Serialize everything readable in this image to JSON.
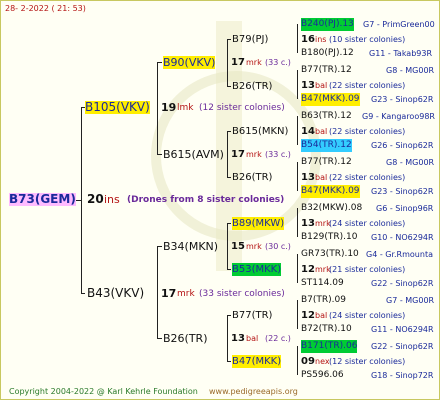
{
  "header": {
    "date": "28-  2-2022  ( 21: 53)"
  },
  "root": {
    "name": "B73(GEM)",
    "count": "20",
    "unit": "ins",
    "note": "(Drones from 8 sister colonies)"
  },
  "gen1": [
    {
      "name": "B105(VKV)",
      "count": "19",
      "unit": "lmk",
      "note": "(12 sister colonies)"
    },
    {
      "name": "B43(VKV)",
      "count": "17",
      "unit": "mrk",
      "note": "(33 sister colonies)"
    }
  ],
  "gen2": [
    {
      "name": "B90(VKV)",
      "count": "17",
      "unit": "mrk",
      "note": "(33 c.)"
    },
    {
      "name": "B615(AVM)",
      "count": "17",
      "unit": "mrk",
      "note": "(33 c.)"
    },
    {
      "name": "B34(MKN)",
      "count": "15",
      "unit": "mrk",
      "note": "(30 c.)"
    },
    {
      "name": "B26(TR)",
      "count": "13",
      "unit": "bal",
      "note": "(22 c.)"
    }
  ],
  "gen3": [
    {
      "name": "B79(PJ)",
      "count": "16",
      "unit": "ins",
      "note": "(10 sister colonies)"
    },
    {
      "name": "B26(TR)",
      "count": "13",
      "unit": "bal",
      "note": "(22 sister colonies)"
    },
    {
      "name": "B615(MKN)",
      "count": "14",
      "unit": "bal",
      "note": "(22 sister colonies)"
    },
    {
      "name": "B26(TR)",
      "count": "13",
      "unit": "bal",
      "note": "(22 sister colonies)"
    },
    {
      "name": "B89(MKW)",
      "count": "13",
      "unit": "mrk",
      "note": "(24 sister colonies)"
    },
    {
      "name": "B53(MKK)",
      "count": "12",
      "unit": "mrk",
      "note": "(21 sister colonies)"
    },
    {
      "name": "B77(TR)",
      "count": "12",
      "unit": "bal",
      "note": "(24 sister colonies)"
    },
    {
      "name": "B47(MKK)",
      "count": "09",
      "unit": "nex",
      "note": "(12 sister colonies)"
    }
  ],
  "gen4": [
    {
      "name": "B240(PJ).13",
      "line": "G7 - PrimGreen00"
    },
    {
      "name": "B180(PJ).12",
      "line": "G11 - Takab93R"
    },
    {
      "name": "B77(TR).12",
      "line": "G8 - MG00R"
    },
    {
      "name": "B47(MKK).09",
      "line": "G23 - Sinop62R"
    },
    {
      "name": "B63(TR).12",
      "line": "G9 - Kangaroo98R"
    },
    {
      "name": "B54(TR).12",
      "line": "G26 - Sinop62R"
    },
    {
      "name": "B77(TR).12",
      "line": "G8 - MG00R"
    },
    {
      "name": "B47(MKK).09",
      "line": "G23 - Sinop62R"
    },
    {
      "name": "B32(MKW).08",
      "line": "G6 - Sinop96R"
    },
    {
      "name": "B129(TR).10",
      "line": "G10 - NO6294R"
    },
    {
      "name": "GR73(TR).10",
      "line": "G4 - Gr.Rmounta"
    },
    {
      "name": "ST114.09",
      "line": "G22 - Sinop62R"
    },
    {
      "name": "B7(TR).09",
      "line": "G7 - MG00R"
    },
    {
      "name": "B72(TR).10",
      "line": "G11 - NO6294R"
    },
    {
      "name": "B171(TR).06",
      "line": "G22 - Sinop62R"
    },
    {
      "name": "PS596.06",
      "line": "G18 - Sinop72R"
    }
  ],
  "footer": {
    "copyright": "Copyright 2004-2022 @ Karl Kehrle Foundation",
    "site": "www.pedigreeapis.org"
  },
  "colors": {
    "navy": "#1a2a9a",
    "red": "#b41414",
    "purple": "#6a2a9a",
    "yellow": "#ffee00",
    "green": "#00cc33",
    "cyan": "#33ccff",
    "pink": "#ffbbff"
  }
}
